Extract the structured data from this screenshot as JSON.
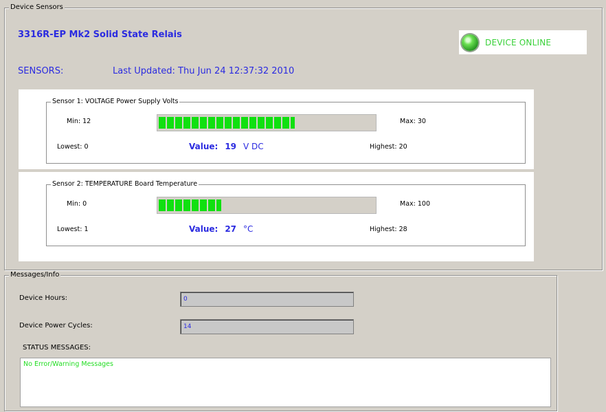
{
  "sensors_group": {
    "legend": "Device Sensors"
  },
  "device": {
    "title": "3316R-EP Mk2 Solid  State Relais",
    "status": "DEVICE ONLINE"
  },
  "sensors_header": {
    "label": "SENSORS:",
    "last_updated": "Last Updated: Thu Jun 24 12:37:32 2010"
  },
  "sensors": [
    {
      "legend": "Sensor 1: VOLTAGE  Power Supply Volts",
      "min": "Min: 12",
      "max": "Max: 30",
      "lowest": "Lowest: 0",
      "highest": "Highest: 20",
      "value_label": "Value:",
      "value": "19",
      "unit": "V DC",
      "level": 0.63
    },
    {
      "legend": "Sensor 2: TEMPERATURE  Board Temperature",
      "min": "Min: 0",
      "max": "Max: 100",
      "lowest": "Lowest: 1",
      "highest": "Highest: 28",
      "value_label": "Value:",
      "value": "27",
      "unit": "°C",
      "level": 0.29
    }
  ],
  "messages": {
    "legend": "Messages/Info",
    "device_hours_label": "Device Hours:",
    "device_hours": "0",
    "power_cycles_label": "Device Power Cycles:",
    "power_cycles": "14",
    "status_label": "STATUS MESSAGES:",
    "status_text": "No Error/Warning Messages"
  },
  "colors": {
    "accent": "#2b2be0",
    "ok": "#22dd22",
    "bar": "#10e010"
  }
}
